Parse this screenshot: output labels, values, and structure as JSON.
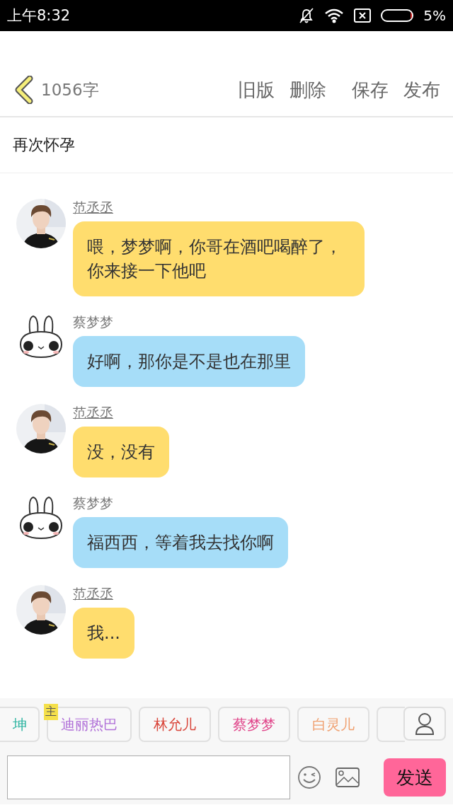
{
  "status_bar": {
    "time": "上午8:32",
    "battery_text": "5%",
    "battery": {
      "level": 0.05
    }
  },
  "header": {
    "word_count": "1056字",
    "actions": [
      "旧版",
      "删除",
      "保存",
      "发布"
    ]
  },
  "title": "再次怀孕",
  "messages": [
    {
      "sender": "范丞丞",
      "underlined": true,
      "color": "#ffdd6e",
      "text": "喂，梦梦啊，你哥在酒吧喝醉了，你来接一下他吧"
    },
    {
      "sender": "蔡梦梦",
      "kind": "bunny",
      "underlined": false,
      "color": "#a6ddf8",
      "text": "好啊，那你是不是也在那里"
    },
    {
      "sender": "范丞丞",
      "underlined": true,
      "color": "#ffdd6e",
      "text": "没，没有"
    },
    {
      "sender": "蔡梦梦",
      "kind": "bunny",
      "underlined": false,
      "color": "#a6ddf8",
      "text": "福西西，等着我去找你啊"
    },
    {
      "sender": "范丞丞",
      "underlined": true,
      "color": "#ffdd6e",
      "text": "我..."
    }
  ],
  "characters": [
    {
      "name": "坤",
      "color": "#2bb3a0"
    },
    {
      "name": "迪丽热巴",
      "color": "#b070d8",
      "badge": "主"
    },
    {
      "name": "林允儿",
      "color": "#d9453a"
    },
    {
      "name": "蔡梦梦",
      "color": "#e0458a"
    },
    {
      "name": "白灵儿",
      "color": "#f0a070"
    }
  ],
  "composer": {
    "send": "发送"
  }
}
